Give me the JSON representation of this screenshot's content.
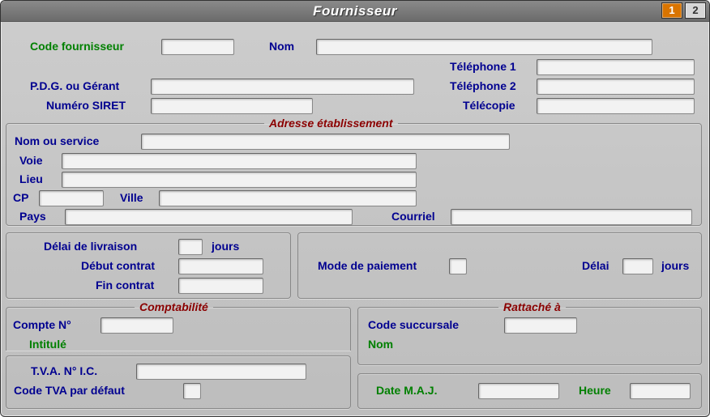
{
  "window": {
    "title": "Fournisseur"
  },
  "pages": {
    "active": "1",
    "other": "2"
  },
  "top": {
    "codeFournisseurLabel": "Code fournisseur",
    "codeFournisseur": "",
    "nomLabel": "Nom",
    "nom": "",
    "pdgLabel": "P.D.G. ou Gérant",
    "pdg": "",
    "siretLabel": "Numéro SIRET",
    "siret": "",
    "tel1Label": "Téléphone 1",
    "tel1": "",
    "tel2Label": "Téléphone 2",
    "tel2": "",
    "faxLabel": "Télécopie",
    "fax": ""
  },
  "adresse": {
    "legend": "Adresse établissement",
    "nomServiceLabel": "Nom ou service",
    "nomService": "",
    "voieLabel": "Voie",
    "voie": "",
    "lieuLabel": "Lieu",
    "lieu": "",
    "cpLabel": "CP",
    "cp": "",
    "villeLabel": "Ville",
    "ville": "",
    "paysLabel": "Pays",
    "pays": "",
    "courrielLabel": "Courriel",
    "courriel": ""
  },
  "livraison": {
    "delaiLabel": "Délai de livraison",
    "delai": "",
    "joursLabel": "jours",
    "debutLabel": "Début contrat",
    "debut": "",
    "finLabel": "Fin contrat",
    "fin": ""
  },
  "paiement": {
    "modeLabel": "Mode de paiement",
    "mode": "",
    "delaiLabel": "Délai",
    "delai": "",
    "joursLabel": "jours"
  },
  "compta": {
    "legend": "Comptabilité",
    "compteLabel": "Compte N°",
    "compte": "",
    "intituleLabel": "Intitulé",
    "tvaIcLabel": "T.V.A. N° I.C.",
    "tvaIc": "",
    "codeTvaLabel": "Code TVA par défaut",
    "codeTva": ""
  },
  "rattache": {
    "legend": "Rattaché à",
    "codeSuccLabel": "Code succursale",
    "codeSucc": "",
    "nomLabel": "Nom"
  },
  "maj": {
    "dateLabel": "Date M.A.J.",
    "date": "",
    "heureLabel": "Heure",
    "heure": ""
  }
}
